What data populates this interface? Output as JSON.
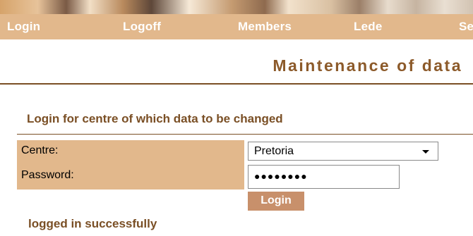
{
  "nav": {
    "items": [
      {
        "label": "Login"
      },
      {
        "label": "Logoff"
      },
      {
        "label": "Members"
      },
      {
        "label": "Lede"
      },
      {
        "label": "Se"
      }
    ]
  },
  "page": {
    "title": "Maintenance of data"
  },
  "form": {
    "heading": "Login for centre of which data to be changed",
    "centre_label": "Centre:",
    "centre_value": "Pretoria",
    "password_label": "Password:",
    "password_mask": "●●●●●●●●",
    "login_button": "Login"
  },
  "status": {
    "message": "logged in successfully"
  },
  "colors": {
    "nav_background": "#e2b88c",
    "accent_text": "#7a4f25",
    "button_background": "#c8906b"
  }
}
